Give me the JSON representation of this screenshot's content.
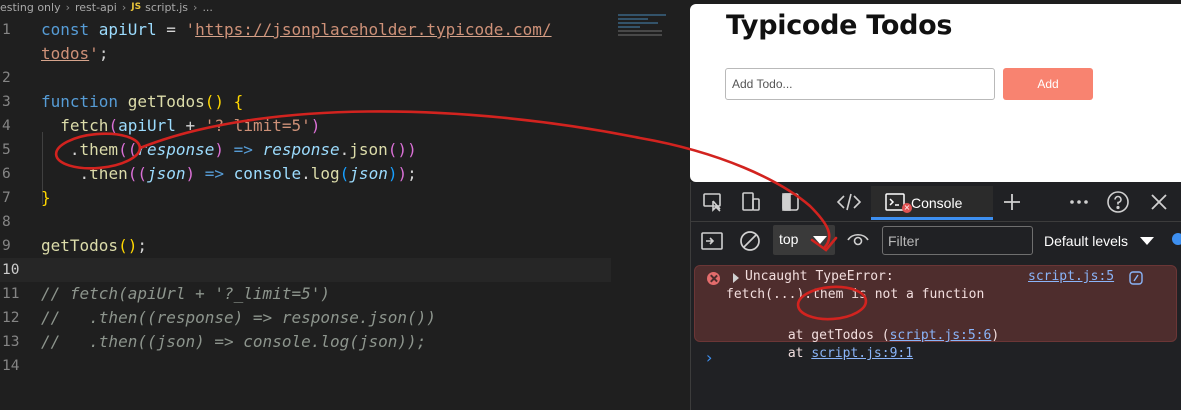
{
  "breadcrumb": {
    "items": [
      "esting only",
      "rest-api"
    ],
    "file_badge": "JS",
    "file_name": "script.js",
    "tail": "..."
  },
  "editor": {
    "lines": [
      {
        "n": "1",
        "tokens": [
          [
            "kw",
            "const "
          ],
          [
            "vr",
            "apiUrl"
          ],
          [
            "pl",
            " = "
          ],
          [
            "str",
            "'"
          ],
          [
            "url",
            "https://jsonplaceholder.typicode.com/"
          ]
        ]
      },
      {
        "n": "",
        "tokens": [
          [
            "url",
            "todos"
          ],
          [
            "str",
            "'"
          ],
          [
            "pl",
            ";"
          ]
        ]
      },
      {
        "n": "2",
        "tokens": []
      },
      {
        "n": "3",
        "tokens": [
          [
            "kw",
            "function "
          ],
          [
            "fn",
            "getTodos"
          ],
          [
            "br1",
            "() {"
          ]
        ]
      },
      {
        "n": "4",
        "tokens": [
          [
            "pl",
            "  "
          ],
          [
            "fn",
            "fetch"
          ],
          [
            "br2",
            "("
          ],
          [
            "vr",
            "apiUrl"
          ],
          [
            "pl",
            " + "
          ],
          [
            "str",
            "'? limit=5'"
          ],
          [
            "br2",
            ")"
          ]
        ]
      },
      {
        "n": "5",
        "tokens": [
          [
            "pl",
            "   ."
          ],
          [
            "fn",
            "them"
          ],
          [
            "br2",
            "(("
          ],
          [
            "par",
            "response"
          ],
          [
            "br2",
            ")"
          ],
          [
            "kw",
            " => "
          ],
          [
            "par",
            "response"
          ],
          [
            "pl",
            "."
          ],
          [
            "fn",
            "json"
          ],
          [
            "br2",
            "())"
          ]
        ]
      },
      {
        "n": "6",
        "tokens": [
          [
            "pl",
            "    ."
          ],
          [
            "fn",
            "then"
          ],
          [
            "br2",
            "(("
          ],
          [
            "par",
            "json"
          ],
          [
            "br2",
            ")"
          ],
          [
            "kw",
            " => "
          ],
          [
            "vr",
            "console"
          ],
          [
            "pl",
            "."
          ],
          [
            "fn",
            "log"
          ],
          [
            "br3",
            "("
          ],
          [
            "par",
            "json"
          ],
          [
            "br3",
            ")"
          ],
          [
            "br2",
            ")"
          ],
          [
            "pl",
            ";"
          ]
        ]
      },
      {
        "n": "7",
        "tokens": [
          [
            "br1",
            "}"
          ]
        ]
      },
      {
        "n": "8",
        "tokens": []
      },
      {
        "n": "9",
        "tokens": [
          [
            "fn",
            "getTodos"
          ],
          [
            "br1",
            "()"
          ],
          [
            "pl",
            ";"
          ]
        ]
      },
      {
        "n": "10",
        "tokens": [],
        "current": true
      },
      {
        "n": "11",
        "tokens": [
          [
            "cm",
            "// fetch(apiUrl + '?_limit=5')"
          ]
        ]
      },
      {
        "n": "12",
        "tokens": [
          [
            "cm",
            "//   .then((response) => response.json())"
          ]
        ]
      },
      {
        "n": "13",
        "tokens": [
          [
            "cm",
            "//   .then((json) => console.log(json));"
          ]
        ]
      },
      {
        "n": "14",
        "tokens": []
      }
    ]
  },
  "preview": {
    "title": "Typicode Todos",
    "input_placeholder": "Add Todo...",
    "add_label": "Add",
    "accent": "#f88370"
  },
  "devtools": {
    "tabs": {
      "console_label": "Console"
    },
    "filter_bar": {
      "context": "top",
      "filter_placeholder": "Filter",
      "levels": "Default levels"
    },
    "error": {
      "line1": "Uncaught TypeError:",
      "line2": "fetch(...).them is not a function",
      "line3_prefix": "    at getTodos (",
      "line3_link": "script.js:5:6",
      "line3_suffix": ")",
      "line4_prefix": "    at ",
      "line4_link": "script.js:9:1",
      "source_link": "script.js:5"
    },
    "prompt": "›",
    "colors": {
      "error_bg": "#4e2d2d",
      "link": "#8ab4f8",
      "tab_underline": "#3d8ff0"
    }
  },
  "icons": {
    "tabs_toolbar": [
      "inspect-icon",
      "device-toolbar-icon",
      "panel-toggle-icon",
      "elements-code-icon",
      "console-icon",
      "plus-icon",
      "more-icon",
      "help-icon",
      "close-icon"
    ],
    "filter_toolbar": [
      "sidebar-icon",
      "clear-console-icon",
      "eye-icon"
    ]
  }
}
